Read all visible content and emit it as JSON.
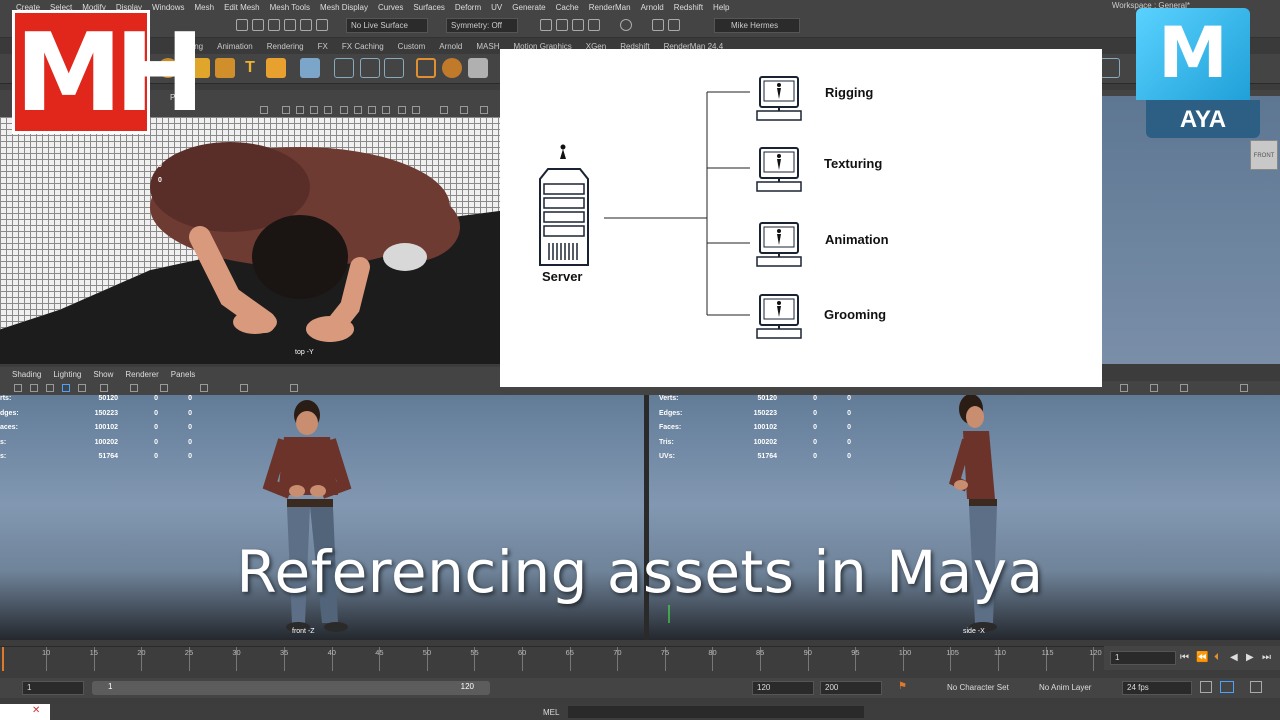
{
  "menu": [
    "Create",
    "Select",
    "Modify",
    "Display",
    "Windows",
    "Mesh",
    "Edit Mesh",
    "Mesh Tools",
    "Mesh Display",
    "Curves",
    "Surfaces",
    "Deform",
    "UV",
    "Generate",
    "Cache",
    "RenderMan",
    "Arnold",
    "Redshift",
    "Help"
  ],
  "workspace": "Workspace : General*",
  "status_line": {
    "live_surface": "No Live Surface",
    "symmetry": "Symmetry: Off",
    "user": "Mike Hermes"
  },
  "shelf_tabs": [
    "Rigging",
    "Animation",
    "Rendering",
    "FX",
    "FX Caching",
    "Custom",
    "Arnold",
    "MASH",
    "Motion Graphics",
    "XGen",
    "Redshift",
    "RenderMan 24.4"
  ],
  "panel_menu_top": [
    "Panels"
  ],
  "panel_menu_bottom": [
    "Shading",
    "Lighting",
    "Show",
    "Renderer",
    "Panels"
  ],
  "top_view": {
    "label": "top -Y",
    "hud_values": [
      "0",
      "0"
    ]
  },
  "front_view": {
    "label": "front -Z",
    "hud": [
      {
        "key": "rts:",
        "v1": "50120",
        "v2": "0",
        "v3": "0"
      },
      {
        "key": "dges:",
        "v1": "150223",
        "v2": "0",
        "v3": "0"
      },
      {
        "key": "aces:",
        "v1": "100102",
        "v2": "0",
        "v3": "0"
      },
      {
        "key": "s:",
        "v1": "100202",
        "v2": "0",
        "v3": "0"
      },
      {
        "key": "s:",
        "v1": "51764",
        "v2": "0",
        "v3": "0"
      }
    ]
  },
  "side_view": {
    "label": "side -X",
    "hud": [
      {
        "key": "Verts:",
        "v1": "50120",
        "v2": "0",
        "v3": "0"
      },
      {
        "key": "Edges:",
        "v1": "150223",
        "v2": "0",
        "v3": "0"
      },
      {
        "key": "Faces:",
        "v1": "100102",
        "v2": "0",
        "v3": "0"
      },
      {
        "key": "Tris:",
        "v1": "100202",
        "v2": "0",
        "v3": "0"
      },
      {
        "key": "UVs:",
        "v1": "51764",
        "v2": "0",
        "v3": "0"
      }
    ]
  },
  "persp_view": {
    "viewcube_label": "FRONT"
  },
  "logos": {
    "left": "MH",
    "right_top": "M",
    "right_bottom": "AYA"
  },
  "diagram": {
    "server_label": "Server",
    "clients": [
      "Rigging",
      "Texturing",
      "Animation",
      "Grooming"
    ]
  },
  "title": "Referencing assets in Maya",
  "timeline": {
    "ticks": [
      "10",
      "15",
      "20",
      "25",
      "30",
      "35",
      "40",
      "45",
      "50",
      "55",
      "60",
      "65",
      "70",
      "75",
      "80",
      "85",
      "90",
      "95",
      "100",
      "105",
      "110",
      "115",
      "120"
    ],
    "current_frame": "1"
  },
  "range": {
    "start": "1",
    "inner_start": "1",
    "inner_end": "120",
    "end": "120",
    "anim_end": "200",
    "character_set": "No Character Set",
    "anim_layer": "No Anim Layer",
    "fps": "24 fps"
  },
  "command_line": {
    "label": "MEL"
  },
  "colors": {
    "logo_red": "#e1261c",
    "maya_blue": "#3ab8ee",
    "maya_dark": "#2c5f83",
    "playhead": "#e07a2a"
  }
}
